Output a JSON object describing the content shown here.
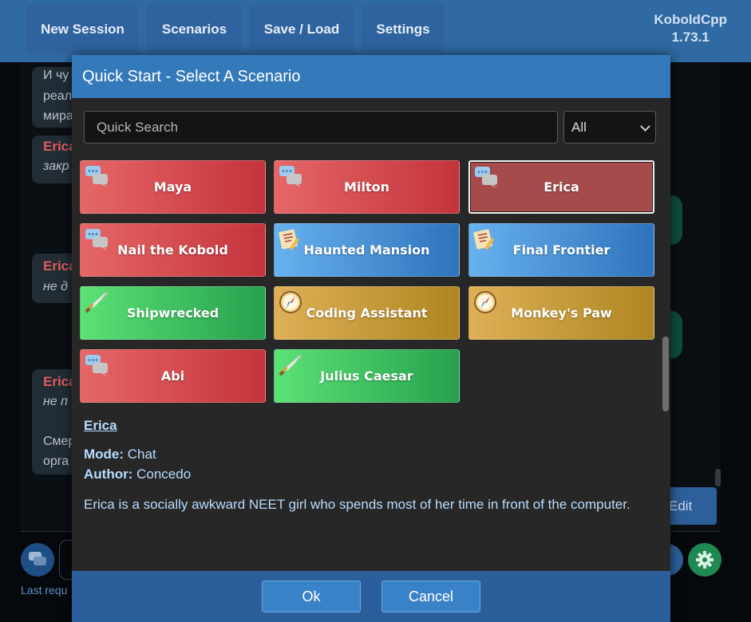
{
  "nav": {
    "new_session": "New Session",
    "scenarios": "Scenarios",
    "save_load": "Save / Load",
    "settings": "Settings"
  },
  "brand": {
    "name": "KoboldCpp",
    "version": "1.73.1"
  },
  "background": {
    "messages": [
      {
        "lines": [
          "И чу",
          "реал",
          "мира"
        ]
      },
      {
        "name": "Erica",
        "lines": [
          "закр"
        ]
      },
      {
        "name": "Erica",
        "lines": [
          "не д"
        ]
      },
      {
        "name": "Erica",
        "lines": [
          "не п",
          "",
          "Смер",
          "орга"
        ]
      }
    ],
    "edit_label": "Edit",
    "last_request": "Last requ"
  },
  "modal": {
    "title": "Quick Start - Select A Scenario",
    "search_placeholder": "Quick Search",
    "filter_value": "All",
    "scenarios": [
      {
        "label": "Maya",
        "color": "red",
        "icon": "chat-bubbles-icon"
      },
      {
        "label": "Milton",
        "color": "red",
        "icon": "chat-bubbles-icon"
      },
      {
        "label": "Erica",
        "color": "red",
        "icon": "chat-bubbles-icon",
        "selected": true
      },
      {
        "label": "Nail the Kobold",
        "color": "red",
        "icon": "chat-bubbles-icon"
      },
      {
        "label": "Haunted Mansion",
        "color": "blue",
        "icon": "scroll-pencil-icon"
      },
      {
        "label": "Final Frontier",
        "color": "blue",
        "icon": "scroll-pencil-icon"
      },
      {
        "label": "Shipwrecked",
        "color": "green",
        "icon": "sword-icon"
      },
      {
        "label": "Coding Assistant",
        "color": "gold",
        "icon": "compass-icon"
      },
      {
        "label": "Monkey's Paw",
        "color": "gold",
        "icon": "compass-icon"
      },
      {
        "label": "Abi",
        "color": "red",
        "icon": "chat-bubbles-icon"
      },
      {
        "label": "Julius Caesar",
        "color": "green",
        "icon": "sword-icon"
      }
    ],
    "detail": {
      "title": "Erica",
      "mode_label": "Mode:",
      "mode_value": "Chat",
      "author_label": "Author:",
      "author_value": "Concedo",
      "description": "Erica is a socially awkward NEET girl who spends most of her time in front of the computer."
    },
    "ok_label": "Ok",
    "cancel_label": "Cancel"
  },
  "colors": {
    "header": "#3479b9",
    "footer": "#2b5f9b",
    "red_tile": "#c4333b",
    "blue_tile": "#2e73bc",
    "green_tile": "#27a04e",
    "gold_tile": "#ad8621",
    "detail_text": "#b6dcff"
  }
}
